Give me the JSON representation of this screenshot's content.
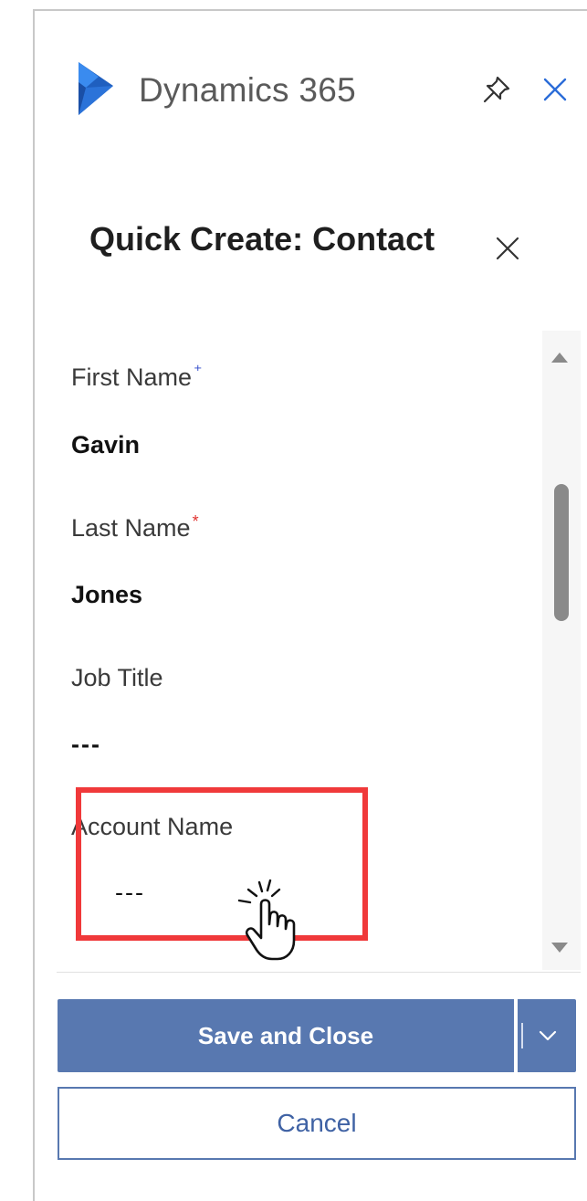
{
  "app": {
    "title": "Dynamics 365",
    "brand_color": "#2b6cd8",
    "pin_icon": "pin-icon",
    "close_icon": "close-icon"
  },
  "quick_create": {
    "title": "Quick Create: Contact",
    "close_icon": "close-icon",
    "fields": [
      {
        "label": "First Name",
        "required_marker": "⁺",
        "required_color": "#2b46c8",
        "value": "Gavin"
      },
      {
        "label": "Last Name",
        "required_marker": "*",
        "required_color": "#e0322f",
        "value": "Jones"
      },
      {
        "label": "Job Title",
        "value": "---"
      },
      {
        "label": "Account Name",
        "value": "---"
      }
    ]
  },
  "actions": {
    "save_label": "Save and Close",
    "cancel_label": "Cancel",
    "accent_color": "#5878b0"
  },
  "annotation": {
    "highlight_color": "#f0393a",
    "cursor_icon": "hand-pointer-icon"
  }
}
